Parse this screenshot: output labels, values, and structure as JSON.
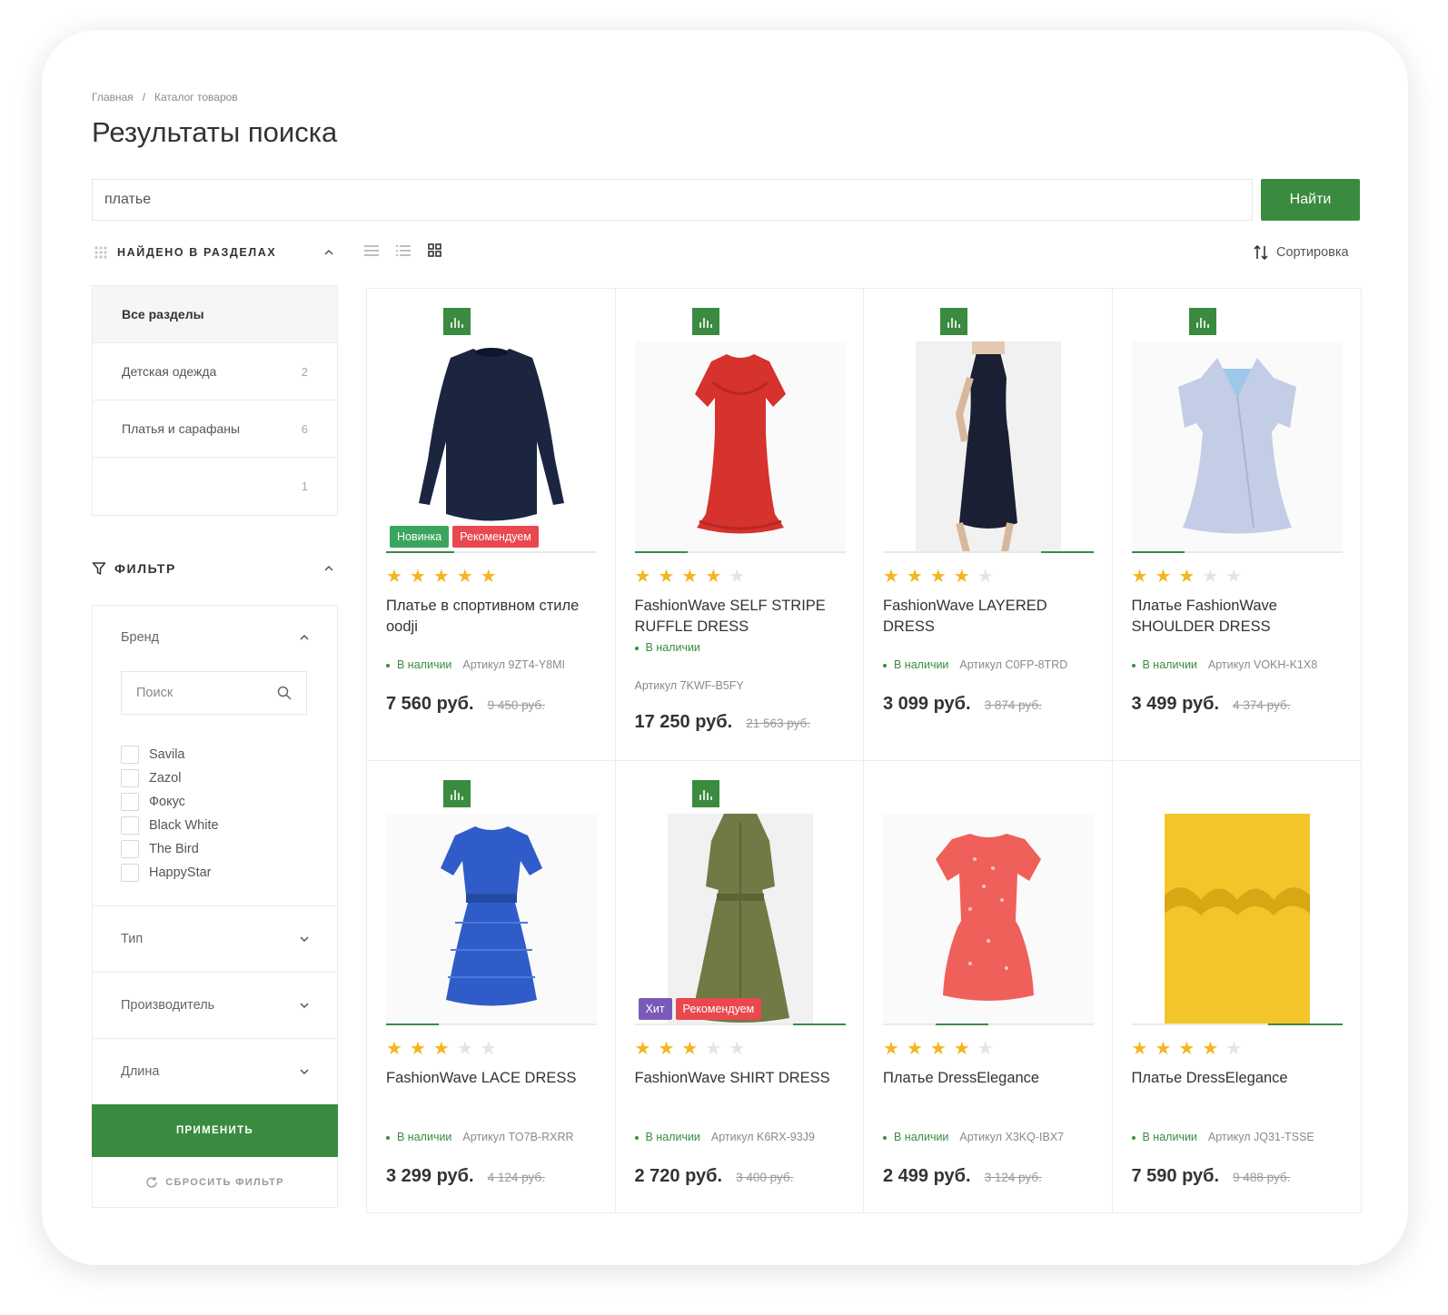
{
  "breadcrumbs": [
    "Главная",
    "/",
    "Каталог товаров"
  ],
  "page_title": "Результаты поиска",
  "search": {
    "value": "платье",
    "button": "Найти"
  },
  "sections": {
    "title": "НАЙДЕНО В РАЗДЕЛАХ",
    "items": [
      {
        "label": "Все разделы",
        "count": ""
      },
      {
        "label": "Детская одежда",
        "count": "2"
      },
      {
        "label": "Платья и сарафаны",
        "count": "6"
      },
      {
        "label": "",
        "count": "1"
      }
    ]
  },
  "filter": {
    "title": "ФИЛЬТР",
    "brand": {
      "title": "Бренд",
      "search_placeholder": "Поиск",
      "options": [
        "Savila",
        "Zazol",
        "Фокус",
        "Black White",
        "The Bird",
        "HappyStar"
      ]
    },
    "groups": [
      "Тип",
      "Производитель",
      "Длина"
    ],
    "apply": "ПРИМЕНИТЬ",
    "reset": "СБРОСИТЬ ФИЛЬТР"
  },
  "sort_label": "Сортировка",
  "colors": {
    "accent": "#3a8b3f",
    "badge_new": "#3aa55c",
    "badge_recommended": "#e8484e",
    "badge_hit": "#7a5ab8",
    "star": "#f5b51f"
  },
  "products": [
    {
      "name": "Платье в спортивном стиле oodji",
      "stock": "В наличии",
      "sku": "Артикул 9ZT4-Y8MI",
      "price": "7 560 руб.",
      "old_price": "9 450 руб.",
      "rating": 5,
      "badges": [
        "Новинка",
        "Рекомендуем"
      ]
    },
    {
      "name": "FashionWave SELF STRIPE RUFFLE DRESS",
      "stock": "В наличии",
      "sku": "Артикул 7KWF-B5FY",
      "price": "17 250 руб.",
      "old_price": "21 563 руб.",
      "rating": 4,
      "badges": []
    },
    {
      "name": "FashionWave LAYERED DRESS",
      "stock": "В наличии",
      "sku": "Артикул C0FP-8TRD",
      "price": "3 099 руб.",
      "old_price": "3 874 руб.",
      "rating": 4,
      "badges": []
    },
    {
      "name": "Платье FashionWave SHOULDER DRESS",
      "stock": "В наличии",
      "sku": "Артикул VOKH-K1X8",
      "price": "3 499 руб.",
      "old_price": "4 374 руб.",
      "rating": 3,
      "badges": []
    },
    {
      "name": "FashionWave LACE DRESS",
      "stock": "В наличии",
      "sku": "Артикул TO7B-RXRR",
      "price": "3 299 руб.",
      "old_price": "4 124 руб.",
      "rating": 3,
      "badges": []
    },
    {
      "name": "FashionWave SHIRT DRESS",
      "stock": "В наличии",
      "sku": "Артикул K6RX-93J9",
      "price": "2 720 руб.",
      "old_price": "3 400 руб.",
      "rating": 3,
      "badges": [
        "Хит",
        "Рекомендуем"
      ]
    },
    {
      "name": "Платье DressElegance",
      "stock": "В наличии",
      "sku": "Артикул X3KQ-IBX7",
      "price": "2 499 руб.",
      "old_price": "3 124 руб.",
      "rating": 4,
      "badges": []
    },
    {
      "name": "Платье DressElegance",
      "stock": "В наличии",
      "sku": "Артикул JQ31-TSSE",
      "price": "7 590 руб.",
      "old_price": "9 488 руб.",
      "rating": 4,
      "badges": []
    }
  ]
}
